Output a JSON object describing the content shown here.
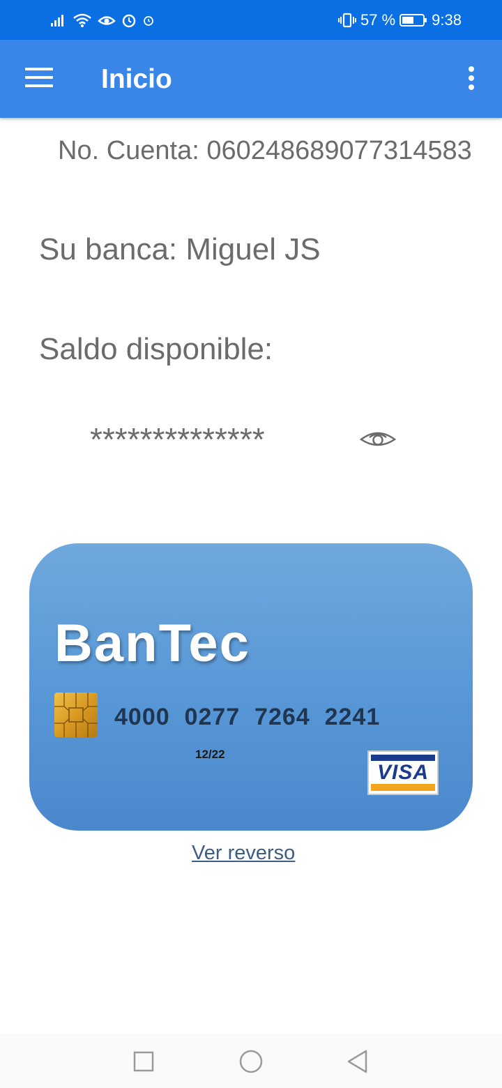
{
  "status_bar": {
    "left_icons": [
      "signal-icon",
      "wifi-icon",
      "eye-comfort-icon",
      "alarm-icon",
      "alarm-small-icon"
    ],
    "vibrate_icon": "vibrate-icon",
    "battery_percent": "57 %",
    "battery_level": 0.57,
    "time": "9:38"
  },
  "app_bar": {
    "menu_icon": "hamburger-menu-icon",
    "title": "Inicio",
    "overflow_icon": "more-vert-icon",
    "color": "#3a86e8"
  },
  "account": {
    "number_text": "No. Cuenta: 060248689077314583",
    "owner_text": "Su banca: Miguel JS",
    "balance_label": "Saldo disponible:",
    "balance_masked": "**************",
    "toggle_icon": "eye-icon"
  },
  "card": {
    "brand": "BanTec",
    "number": "4000  0277  7264  2241",
    "expiry": "12/22",
    "network": "VISA",
    "chip_icon": "chip-icon"
  },
  "reverse_link": "Ver reverso",
  "nav_bar": {
    "icons": [
      "recents-square-icon",
      "home-circle-icon",
      "back-triangle-icon"
    ]
  }
}
